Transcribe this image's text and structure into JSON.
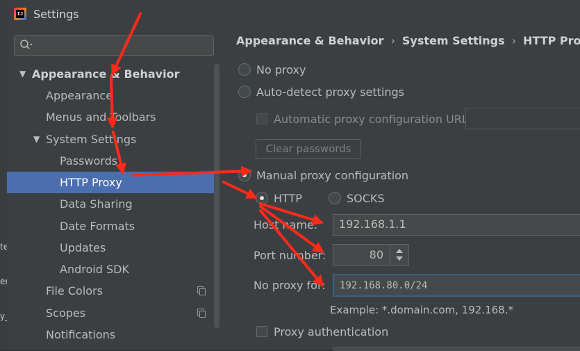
{
  "window": {
    "title": "Settings",
    "logo_text": "IJ"
  },
  "background_ide": {
    "chars": [
      "te",
      "er",
      "y_"
    ]
  },
  "search": {
    "placeholder": ""
  },
  "sidebar": {
    "items": [
      {
        "label": "Appearance & Behavior",
        "expanded": true
      },
      {
        "label": "Appearance"
      },
      {
        "label": "Menus and Toolbars"
      },
      {
        "label": "System Settings",
        "expanded": true
      },
      {
        "label": "Passwords"
      },
      {
        "label": "HTTP Proxy",
        "selected": true
      },
      {
        "label": "Data Sharing"
      },
      {
        "label": "Date Formats"
      },
      {
        "label": "Updates"
      },
      {
        "label": "Android SDK"
      },
      {
        "label": "File Colors"
      },
      {
        "label": "Scopes"
      },
      {
        "label": "Notifications"
      }
    ]
  },
  "breadcrumb": {
    "part1": "Appearance & Behavior",
    "part2": "System Settings",
    "part3": "HTTP Proxy",
    "separator": "›"
  },
  "proxy": {
    "no_proxy_label": "No proxy",
    "auto_detect_label": "Auto-detect proxy settings",
    "auto_config_url_label": "Automatic proxy configuration URL:",
    "auto_config_url_value": "",
    "clear_passwords_label": "Clear passwords",
    "manual_label": "Manual proxy configuration",
    "http_label": "HTTP",
    "socks_label": "SOCKS",
    "host_label": "Host name:",
    "host_value": "192.168.1.1",
    "port_label": "Port number:",
    "port_value": "80",
    "no_proxy_for_label": "No proxy for:",
    "no_proxy_for_value": "192.168.80.0/24",
    "example_text": "Example: *.domain.com, 192.168.*",
    "proxy_auth_label": "Proxy authentication"
  },
  "colors": {
    "selection": "#4b6eaf",
    "arrow": "#ff2a1a",
    "focus_border": "#3d6185"
  }
}
